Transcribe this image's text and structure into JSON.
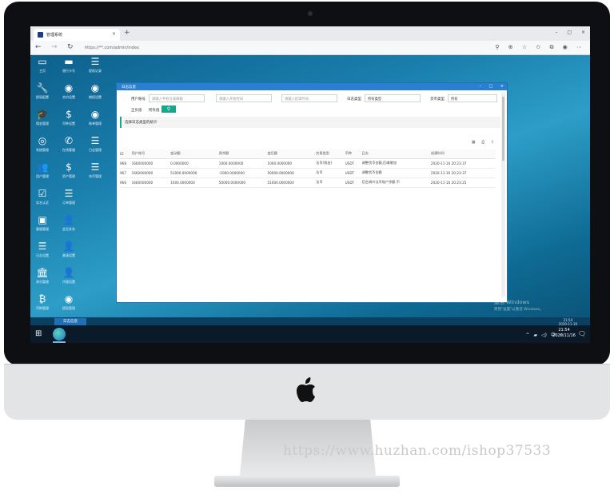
{
  "browser": {
    "tab_title": "管理系统",
    "tab_close": "×",
    "new_tab": "+",
    "window_controls": "–  □  ×",
    "back": "←",
    "forward": "→",
    "refresh": "↻",
    "url": "https://**.com/admin/index",
    "toolbar_icons": "⚲ ⊕ ☆ ✩ ⧉ ◉ ⋯"
  },
  "sidebar": {
    "items": [
      {
        "icon": "monitor-icon",
        "glyph": "▭",
        "label": "主页"
      },
      {
        "icon": "card-icon",
        "glyph": "▬",
        "label": "银行卡号"
      },
      {
        "icon": "list-icon",
        "glyph": "☰",
        "label": "提现记录"
      },
      {
        "icon": "wrench-icon",
        "glyph": "🔧",
        "label": "提现配置"
      },
      {
        "icon": "eye-icon",
        "glyph": "◉",
        "label": "合约设置"
      },
      {
        "icon": "eye-icon",
        "glyph": "◉",
        "label": "期权设置"
      },
      {
        "icon": "graduation-icon",
        "glyph": "🎓",
        "label": "佣金管理"
      },
      {
        "icon": "dollar-icon",
        "glyph": "$",
        "label": "币种设置"
      },
      {
        "icon": "eye-icon",
        "glyph": "◉",
        "label": "账单管理"
      },
      {
        "icon": "user-circle-icon",
        "glyph": "◎",
        "label": "系统管理"
      },
      {
        "icon": "phone-icon",
        "glyph": "✆",
        "label": "在线客服"
      },
      {
        "icon": "list-icon",
        "glyph": "☰",
        "label": "日志管理"
      },
      {
        "icon": "users-icon",
        "glyph": "👥",
        "label": "用户管理"
      },
      {
        "icon": "dollar-icon",
        "glyph": "$",
        "label": "资产管理"
      },
      {
        "icon": "list-icon",
        "glyph": "☰",
        "label": "充币管理"
      },
      {
        "icon": "checkbox-icon",
        "glyph": "☑",
        "label": "实名认证"
      },
      {
        "icon": "list-icon",
        "glyph": "☰",
        "label": "订单管理"
      },
      {
        "icon": "id-card-icon",
        "glyph": "▣",
        "label": "客服管理"
      },
      {
        "icon": "user-add-icon",
        "glyph": "👤",
        "label": "会员关系"
      },
      {
        "icon": "list-icon",
        "glyph": "☰",
        "label": "日志设置"
      },
      {
        "icon": "user-add-icon",
        "glyph": "👤",
        "label": "邀请设置"
      },
      {
        "icon": "bank-icon",
        "glyph": "🏛",
        "label": "承兑管理"
      },
      {
        "icon": "user-add-icon",
        "glyph": "👤",
        "label": "代理设置"
      },
      {
        "icon": "bitcoin-icon",
        "glyph": "₿",
        "label": "币种管理"
      },
      {
        "icon": "eye-icon",
        "glyph": "◉",
        "label": "提现管理"
      }
    ]
  },
  "app": {
    "title": "日志信息",
    "window_controls": "–  □  ×",
    "filters": {
      "user_label": "用户账号",
      "user_placeholder": "请输入手机号或邮箱",
      "start_placeholder": "请输入开始时间",
      "end_placeholder": "请输入结束时间",
      "log_type_label": "日志类型",
      "log_type_value": "所有类型",
      "coin_type_label": "货币类型",
      "coin_type_value": "所有",
      "status_label": "正负值",
      "status_value": "所有值",
      "search_icon": "⚲"
    },
    "tip": "选择日志类型的统计",
    "tools": "▦ ⎙ ⇩",
    "table": {
      "headers": [
        "ID",
        "用户账号",
        "变动额",
        "原余额",
        "变后额",
        "交易类型",
        "币种",
        "日志",
        "创建时间"
      ],
      "rows": [
        [
          "968",
          "1660000000",
          "0.0000000",
          "1000.0000000",
          "1000.0000000",
          "法币(划出)",
          "USDT",
          "调整货币金额,后端增加",
          "2020-11-16 20:23:37"
        ],
        [
          "967",
          "1660000000",
          "51000.0000000",
          "-1000.0000000",
          "50000.0000000",
          "法币",
          "USDT",
          "调整货币金额",
          "2020-11-16 20:23:37"
        ],
        [
          "966",
          "1660000000",
          "1000.0000000",
          "50000.0000000",
          "51000.0000000",
          "法币",
          "USDT",
          "后台调节法币账户余额 币",
          "2020-11-16 20:23:25"
        ]
      ]
    }
  },
  "windows": {
    "activate_title": "激活 Windows",
    "activate_sub": "转到\"设置\"以激活 Windows。",
    "page_tab": "日志信息",
    "page_time": "21:54",
    "page_date": "2020-11-16",
    "tray": "^ ▰ ◁) 中 ⚡",
    "time": "21:54",
    "date": "2020/11/16",
    "notification": "🗨"
  },
  "watermark": "https://www.huzhan.com/ishop37533"
}
